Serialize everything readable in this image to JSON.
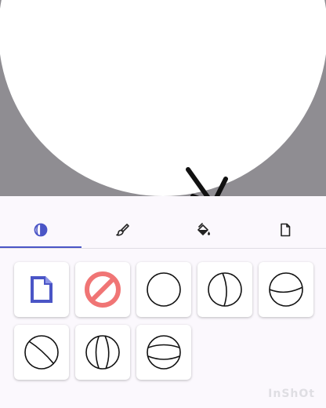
{
  "colors": {
    "canvas_bg": "#8f8d92",
    "accent": "#4a55c6",
    "no_entry": "#f07575",
    "page_bg": "#fbf8fd"
  },
  "tabs": [
    {
      "icon": "contrast-icon",
      "active": true
    },
    {
      "icon": "brush-icon",
      "active": false
    },
    {
      "icon": "paint-bucket-icon",
      "active": false
    },
    {
      "icon": "document-icon",
      "active": false
    }
  ],
  "shapes": [
    {
      "icon": "blank-document-icon"
    },
    {
      "icon": "no-entry-icon"
    },
    {
      "icon": "plain-circle-icon"
    },
    {
      "icon": "circle-vertical-curve-icon"
    },
    {
      "icon": "circle-horizontal-curve-icon"
    },
    {
      "icon": "circle-diagonal-curve-icon"
    },
    {
      "icon": "circle-double-vertical-curve-icon"
    },
    {
      "icon": "circle-double-horizontal-curve-icon"
    }
  ],
  "watermark": "InShOt"
}
